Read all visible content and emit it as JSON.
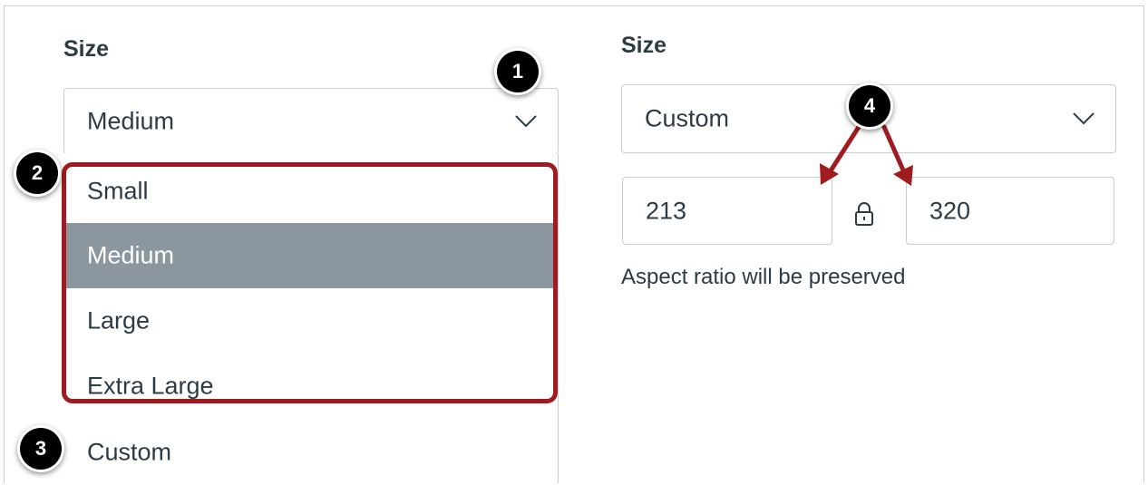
{
  "left_panel": {
    "size_label": "Size",
    "select_value": "Medium",
    "options": [
      "Small",
      "Medium",
      "Large",
      "Extra Large",
      "Custom"
    ],
    "selected_option": "Medium"
  },
  "right_panel": {
    "size_label": "Size",
    "select_value": "Custom",
    "width_value": "213",
    "height_value": "320",
    "aspect_note": "Aspect ratio will be preserved"
  },
  "callouts": [
    "1",
    "2",
    "3",
    "4"
  ],
  "colors": {
    "highlight_border": "#a01b1f",
    "selected_option_bg": "#8b969e",
    "badge_bg": "#000000",
    "arrow": "#a01b1f"
  },
  "icons": {
    "dropdown": "chevron-down-icon",
    "lock": "lock-icon"
  }
}
